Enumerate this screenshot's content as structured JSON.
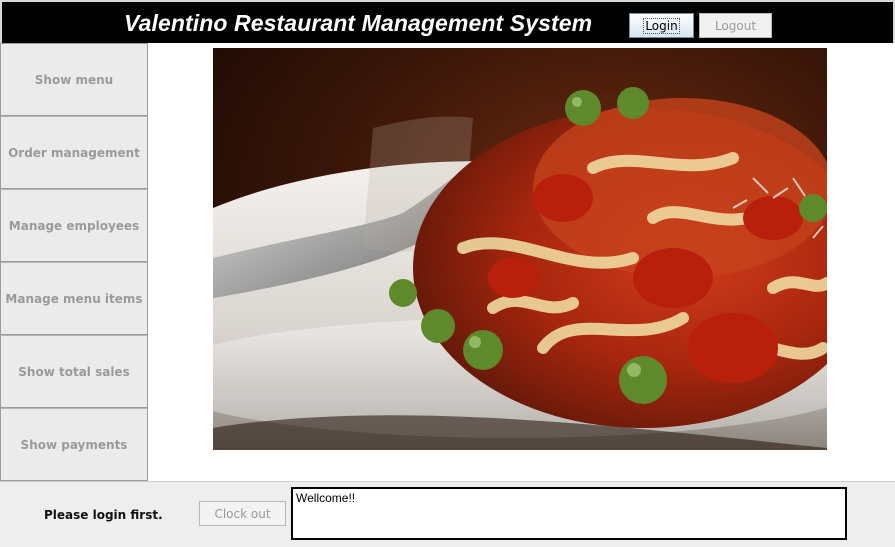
{
  "header": {
    "title": "Valentino Restaurant Management System",
    "login_label": "Login",
    "logout_label": "Logout"
  },
  "sidebar": {
    "items": [
      {
        "label": "Show menu"
      },
      {
        "label": "Order management"
      },
      {
        "label": "Manage employees"
      },
      {
        "label": "Manage menu items"
      },
      {
        "label": "Show total sales"
      },
      {
        "label": "Show payments"
      }
    ]
  },
  "main": {
    "image": "pasta-dish-photo"
  },
  "footer": {
    "status": "Please login first.",
    "clockout_label": "Clock out",
    "message": "Wellcome!!"
  },
  "colors": {
    "titlebar_bg": "#000000",
    "disabled_text": "#9a9a9a",
    "panel_bg": "#ebebeb"
  }
}
